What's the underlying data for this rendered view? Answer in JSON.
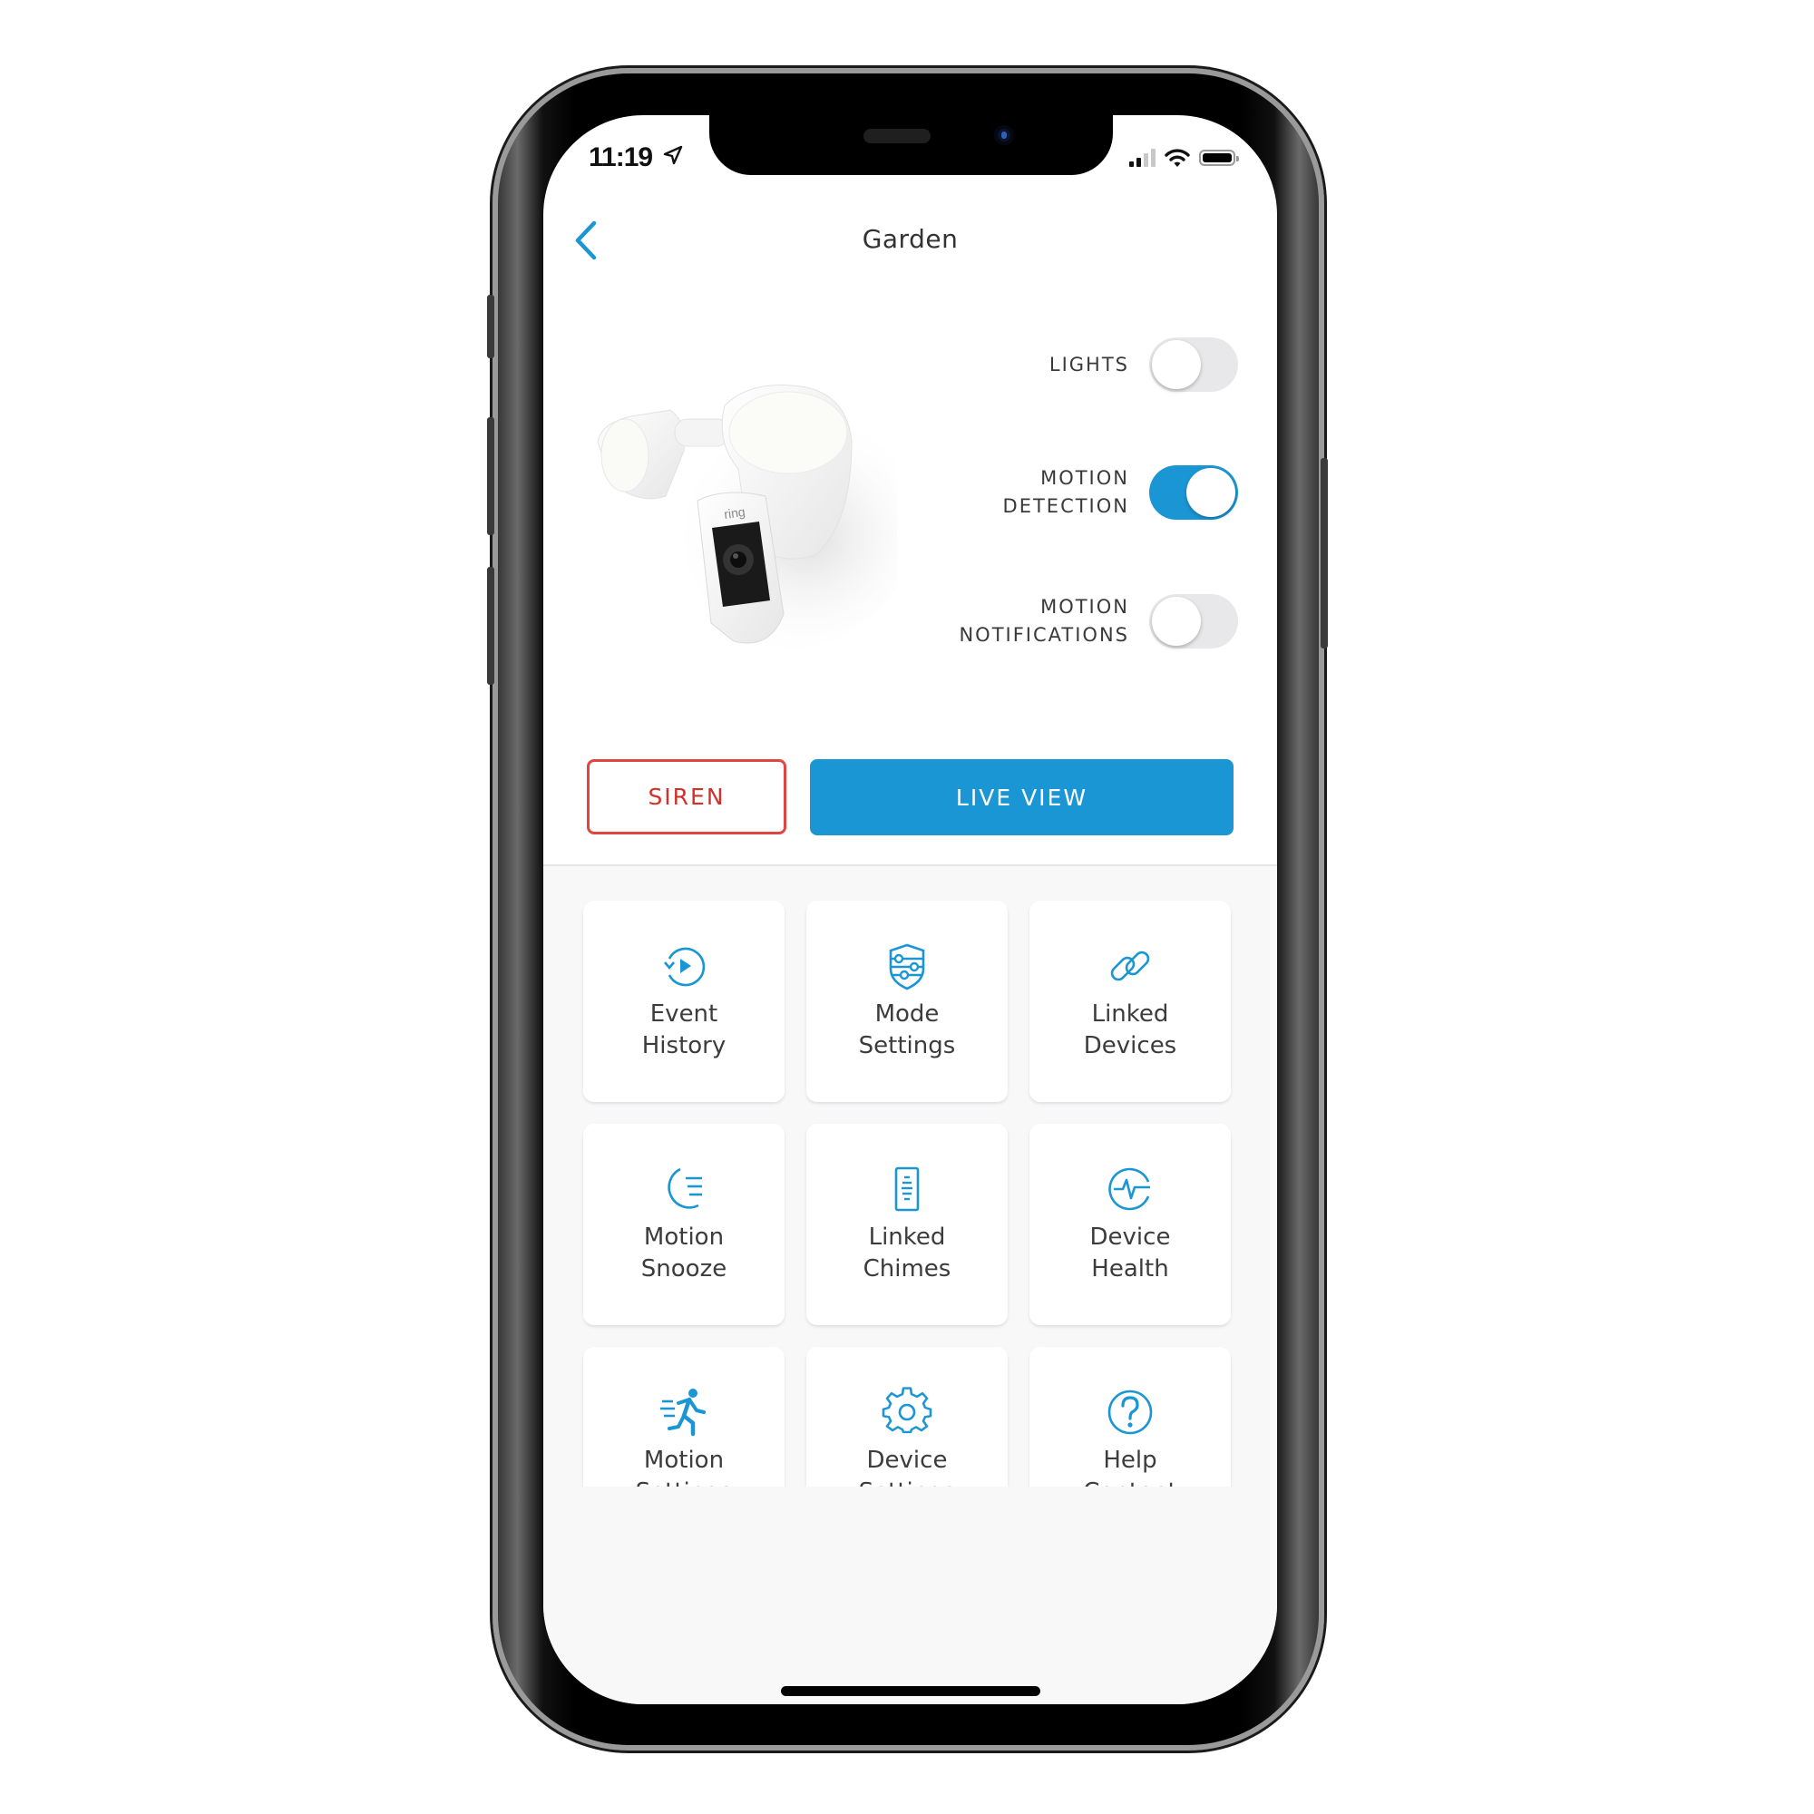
{
  "status_bar": {
    "time": "11:19",
    "location_icon": "location-arrow-icon",
    "signal_bars": 4,
    "signal_active_bars": 2,
    "wifi_icon": "wifi-icon",
    "battery_icon": "battery-full-icon"
  },
  "header": {
    "back_icon": "chevron-left-icon",
    "title": "Garden"
  },
  "device": {
    "image": "floodlight-camera-image",
    "brand_mark": "ring"
  },
  "toggles": [
    {
      "label": "LIGHTS",
      "state": false
    },
    {
      "label": "MOTION\nDETECTION",
      "state": true
    },
    {
      "label": "MOTION\nNOTIFICATIONS",
      "state": false
    }
  ],
  "actions": {
    "siren_label": "SIREN",
    "live_view_label": "LIVE VIEW"
  },
  "tiles": [
    {
      "label": "Event\nHistory",
      "icon": "event-history-icon"
    },
    {
      "label": "Mode\nSettings",
      "icon": "mode-settings-shield-icon"
    },
    {
      "label": "Linked\nDevices",
      "icon": "link-icon"
    },
    {
      "label": "Motion\nSnooze",
      "icon": "moon-snooze-icon"
    },
    {
      "label": "Linked\nChimes",
      "icon": "chime-icon"
    },
    {
      "label": "Device\nHealth",
      "icon": "pulse-health-icon"
    },
    {
      "label": "Motion\nSettings",
      "icon": "running-person-icon"
    },
    {
      "label": "Device\nSettings",
      "icon": "gear-icon"
    },
    {
      "label": "Help\nContent",
      "icon": "help-question-icon"
    },
    {
      "label": "",
      "icon": "shared-users-icon"
    }
  ],
  "colors": {
    "accent": "#1b96d4",
    "siren": "#d2302a",
    "text": "#3c3c3c"
  }
}
